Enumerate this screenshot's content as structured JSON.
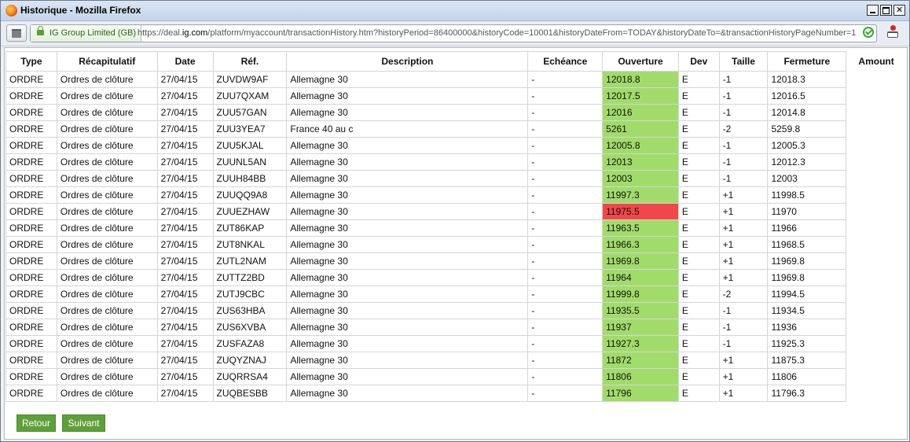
{
  "window": {
    "title": "Historique - Mozilla Firefox"
  },
  "addressbar": {
    "identity": "IG Group Limited (GB)",
    "url_prefix": "https://deal.",
    "url_domain": "ig.com",
    "url_suffix": "/platform/myaccount/transactionHistory.htm?historyPeriod=86400000&historyCode=10001&historyDateFrom=TODAY&historyDateTo=&transactionHistoryPageNumber=1"
  },
  "table": {
    "headers": [
      "Type",
      "Récapitulatif",
      "Date",
      "Réf.",
      "Description",
      "Echéance",
      "Ouverture",
      "Dev",
      "Taille",
      "Fermeture",
      "Amount"
    ],
    "rows": [
      {
        "type": "ORDRE",
        "recap": "Ordres de clôture",
        "date": "27/04/15",
        "ref": "ZUVDW9AF",
        "desc": "Allemagne 30",
        "ech": "-",
        "ouv": "12018.8",
        "dev": "E",
        "taille": "-1",
        "ferm": "12018.3"
      },
      {
        "type": "ORDRE",
        "recap": "Ordres de clôture",
        "date": "27/04/15",
        "ref": "ZUU7QXAM",
        "desc": "Allemagne 30",
        "ech": "-",
        "ouv": "12017.5",
        "dev": "E",
        "taille": "-1",
        "ferm": "12016.5"
      },
      {
        "type": "ORDRE",
        "recap": "Ordres de clôture",
        "date": "27/04/15",
        "ref": "ZUU57GAN",
        "desc": "Allemagne 30",
        "ech": "-",
        "ouv": "12016",
        "dev": "E",
        "taille": "-1",
        "ferm": "12014.8"
      },
      {
        "type": "ORDRE",
        "recap": "Ordres de clôture",
        "date": "27/04/15",
        "ref": "ZUU3YEA7",
        "desc": "France 40 au c",
        "ech": "-",
        "ouv": "5261",
        "dev": "E",
        "taille": "-2",
        "ferm": "5259.8"
      },
      {
        "type": "ORDRE",
        "recap": "Ordres de clôture",
        "date": "27/04/15",
        "ref": "ZUU5KJAL",
        "desc": "Allemagne 30",
        "ech": "-",
        "ouv": "12005.8",
        "dev": "E",
        "taille": "-1",
        "ferm": "12005.3"
      },
      {
        "type": "ORDRE",
        "recap": "Ordres de clôture",
        "date": "27/04/15",
        "ref": "ZUUNL5AN",
        "desc": "Allemagne 30",
        "ech": "-",
        "ouv": "12013",
        "dev": "E",
        "taille": "-1",
        "ferm": "12012.3"
      },
      {
        "type": "ORDRE",
        "recap": "Ordres de clôture",
        "date": "27/04/15",
        "ref": "ZUUH84BB",
        "desc": "Allemagne 30",
        "ech": "-",
        "ouv": "12003",
        "dev": "E",
        "taille": "-1",
        "ferm": "12003"
      },
      {
        "type": "ORDRE",
        "recap": "Ordres de clôture",
        "date": "27/04/15",
        "ref": "ZUUQQ9A8",
        "desc": "Allemagne 30",
        "ech": "-",
        "ouv": "11997.3",
        "dev": "E",
        "taille": "+1",
        "ferm": "11998.5"
      },
      {
        "type": "ORDRE",
        "recap": "Ordres de clôture",
        "date": "27/04/15",
        "ref": "ZUUEZHAW",
        "desc": "Allemagne 30",
        "ech": "-",
        "ouv": "11975.5",
        "dev": "E",
        "taille": "+1",
        "ferm": "11970",
        "highlight": "red"
      },
      {
        "type": "ORDRE",
        "recap": "Ordres de clôture",
        "date": "27/04/15",
        "ref": "ZUT86KAP",
        "desc": "Allemagne 30",
        "ech": "-",
        "ouv": "11963.5",
        "dev": "E",
        "taille": "+1",
        "ferm": "11966"
      },
      {
        "type": "ORDRE",
        "recap": "Ordres de clôture",
        "date": "27/04/15",
        "ref": "ZUT8NKAL",
        "desc": "Allemagne 30",
        "ech": "-",
        "ouv": "11966.3",
        "dev": "E",
        "taille": "+1",
        "ferm": "11968.5"
      },
      {
        "type": "ORDRE",
        "recap": "Ordres de clôture",
        "date": "27/04/15",
        "ref": "ZUTL2NAM",
        "desc": "Allemagne 30",
        "ech": "-",
        "ouv": "11969.8",
        "dev": "E",
        "taille": "+1",
        "ferm": "11969.8"
      },
      {
        "type": "ORDRE",
        "recap": "Ordres de clôture",
        "date": "27/04/15",
        "ref": "ZUTTZ2BD",
        "desc": "Allemagne 30",
        "ech": "-",
        "ouv": "11964",
        "dev": "E",
        "taille": "+1",
        "ferm": "11969.8"
      },
      {
        "type": "ORDRE",
        "recap": "Ordres de clôture",
        "date": "27/04/15",
        "ref": "ZUTJ9CBC",
        "desc": "Allemagne 30",
        "ech": "-",
        "ouv": "11999.8",
        "dev": "E",
        "taille": "-2",
        "ferm": "11994.5"
      },
      {
        "type": "ORDRE",
        "recap": "Ordres de clôture",
        "date": "27/04/15",
        "ref": "ZUS63HBA",
        "desc": "Allemagne 30",
        "ech": "-",
        "ouv": "11935.5",
        "dev": "E",
        "taille": "-1",
        "ferm": "11934.5"
      },
      {
        "type": "ORDRE",
        "recap": "Ordres de clôture",
        "date": "27/04/15",
        "ref": "ZUS6XVBA",
        "desc": "Allemagne 30",
        "ech": "-",
        "ouv": "11937",
        "dev": "E",
        "taille": "-1",
        "ferm": "11936"
      },
      {
        "type": "ORDRE",
        "recap": "Ordres de clôture",
        "date": "27/04/15",
        "ref": "ZUSFAZA8",
        "desc": "Allemagne 30",
        "ech": "-",
        "ouv": "11927.3",
        "dev": "E",
        "taille": "-1",
        "ferm": "11925.3"
      },
      {
        "type": "ORDRE",
        "recap": "Ordres de clôture",
        "date": "27/04/15",
        "ref": "ZUQYZNAJ",
        "desc": "Allemagne 30",
        "ech": "-",
        "ouv": "11872",
        "dev": "E",
        "taille": "+1",
        "ferm": "11875.3"
      },
      {
        "type": "ORDRE",
        "recap": "Ordres de clôture",
        "date": "27/04/15",
        "ref": "ZUQRRSA4",
        "desc": "Allemagne 30",
        "ech": "-",
        "ouv": "11806",
        "dev": "E",
        "taille": "+1",
        "ferm": "11806"
      },
      {
        "type": "ORDRE",
        "recap": "Ordres de clôture",
        "date": "27/04/15",
        "ref": "ZUQBESBB",
        "desc": "Allemagne 30",
        "ech": "-",
        "ouv": "11796",
        "dev": "E",
        "taille": "+1",
        "ferm": "11796.3"
      }
    ]
  },
  "buttons": {
    "back": "Retour",
    "next": "Suivant"
  },
  "colors": {
    "green_cell": "#a1dc6b",
    "red_cell": "#f1474a",
    "button": "#5f9f3a"
  }
}
